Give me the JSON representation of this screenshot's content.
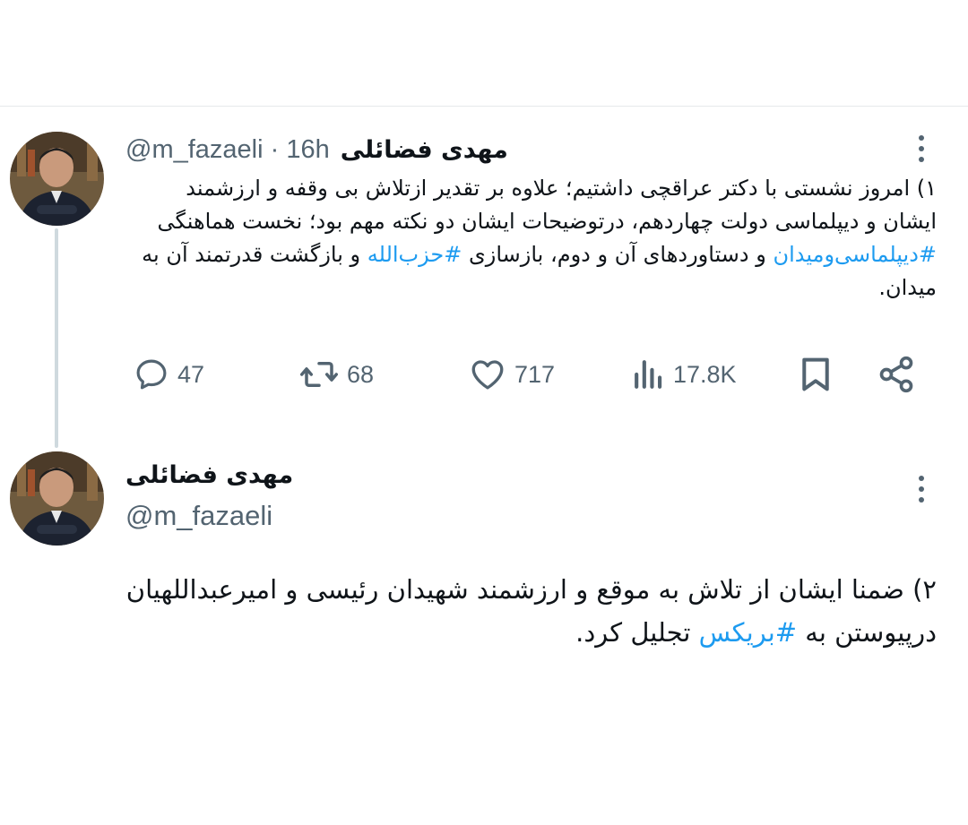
{
  "tweet1": {
    "author_name": "مهدی فضائلی",
    "meta": "@m_fazaeli · 16h",
    "text_parts": [
      "۱) امروز نشستی با دکتر عراقچی داشتیم؛ علاوه بر تقدیر ازتلاش بی وقفه و ارزشمند ایشان و دیپلماسی دولت چهاردهم، درتوضیحات ایشان دو نکته مهم بود؛ نخست هماهنگی ",
      "#دیپلماسی‌ومیدان",
      " و دستاوردهای آن و دوم، بازسازی ",
      "#حزب‌الله",
      " و بازگشت قدرتمند آن به میدان."
    ],
    "actions": {
      "replies": "47",
      "reposts": "68",
      "likes": "717",
      "views": "17.8K"
    }
  },
  "tweet2": {
    "author_name": "مهدی فضائلی",
    "handle": "@m_fazaeli",
    "text_parts": [
      "۲) ضمنا ایشان از تلاش به موقع و ارزشمند شهیدان رئیسی و امیرعبداللهیان درپیوستن به ",
      "#بریکس",
      " تجلیل کرد."
    ]
  },
  "colors": {
    "text": "#0f1419",
    "secondary": "#536471",
    "link": "#1d9bf0",
    "thread_line": "#cfd9de"
  }
}
